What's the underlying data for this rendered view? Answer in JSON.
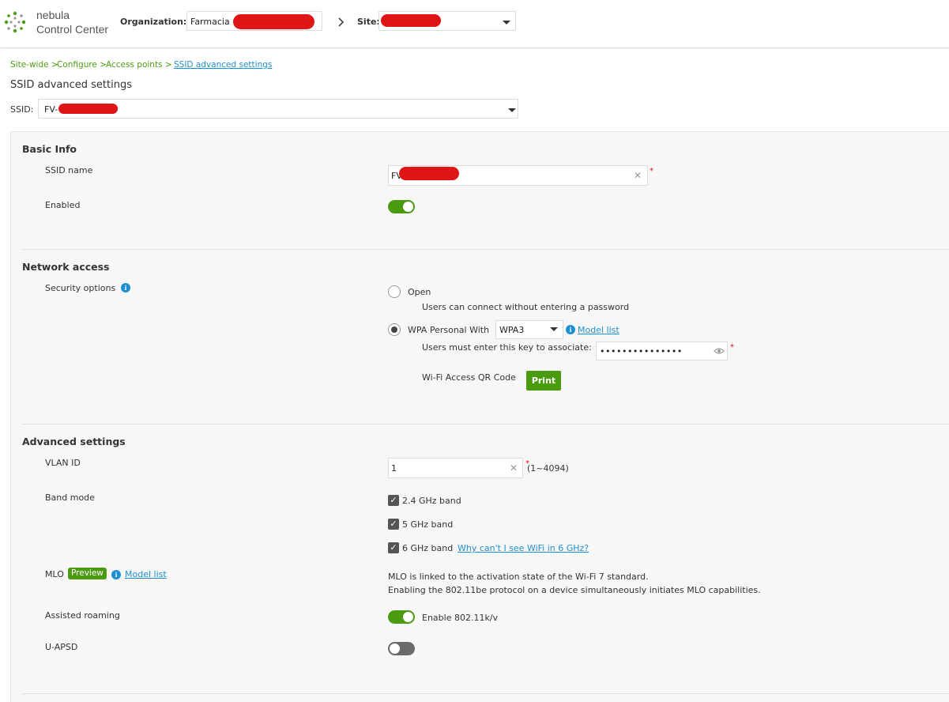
{
  "header": {
    "brand_line1": "nebula",
    "brand_line2": "Control Center",
    "org_label": "Organization:",
    "org_value": "Farmacia",
    "site_label": "Site:"
  },
  "breadcrumb": {
    "items": [
      "Site-wide >",
      "Configure >",
      "Access points >"
    ],
    "current": "SSID advanced settings"
  },
  "page": {
    "title": "SSID advanced settings",
    "ssid_label": "SSID:",
    "ssid_value": "FV-"
  },
  "basic_info": {
    "title": "Basic Info",
    "ssid_name_label": "SSID name",
    "ssid_name_value": "FV",
    "enabled_label": "Enabled",
    "enabled": true
  },
  "network_access": {
    "title": "Network access",
    "security_label": "Security options",
    "open_label": "Open",
    "open_desc": "Users can connect without entering a password",
    "wpa_label": "WPA Personal With",
    "wpa_value": "WPA3",
    "model_list": "Model list",
    "key_label": "Users must enter this key to associate:",
    "key_value": "•••••••••••••••",
    "qr_label": "Wi-Fi Access QR Code",
    "print_button": "Print"
  },
  "advanced": {
    "title": "Advanced settings",
    "vlan_label": "VLAN ID",
    "vlan_value": "1",
    "vlan_range": "(1~4094)",
    "band_label": "Band mode",
    "band_24": "2.4 GHz band",
    "band_5": "5 GHz band",
    "band_6": "6 GHz band",
    "band_6_link": "Why can't I see WiFi in 6 GHz?",
    "mlo_label": "MLO",
    "mlo_badge": "Preview",
    "mlo_model_list": "Model list",
    "mlo_desc1": "MLO is linked to the activation state of the Wi-Fi 7 standard.",
    "mlo_desc2": "Enabling the 802.11be protocol on a device simultaneously initiates MLO capabilities.",
    "roaming_label": "Assisted roaming",
    "roaming_value": "Enable 802.11k/v",
    "roaming_enabled": true,
    "uapsd_label": "U-APSD",
    "uapsd_enabled": false
  },
  "colors": {
    "accent_green": "#4a9b0f",
    "link_blue": "#1d8fd1",
    "toggle_off": "#6b6b6b"
  }
}
